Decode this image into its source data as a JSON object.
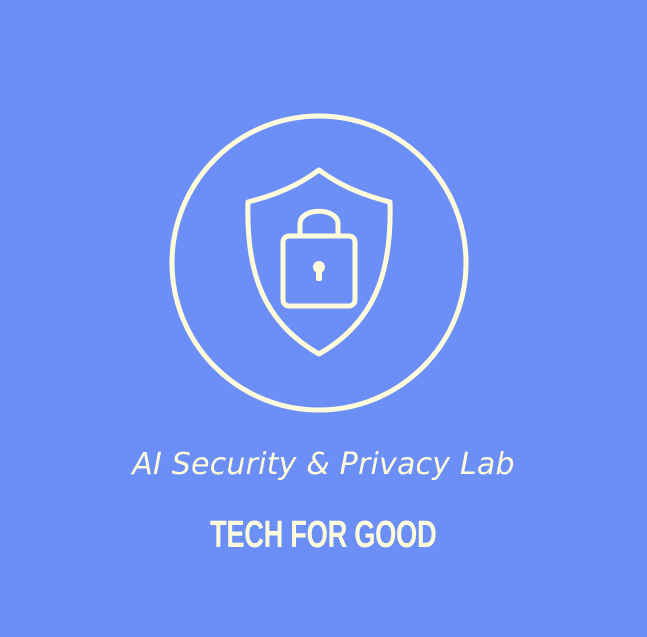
{
  "logo": {
    "title": "AI Security & Privacy Lab",
    "tagline": "TECH FOR GOOD",
    "icon": "shield-lock-icon",
    "colors": {
      "background": "#6b8ff7",
      "foreground": "#fffbdb"
    }
  }
}
